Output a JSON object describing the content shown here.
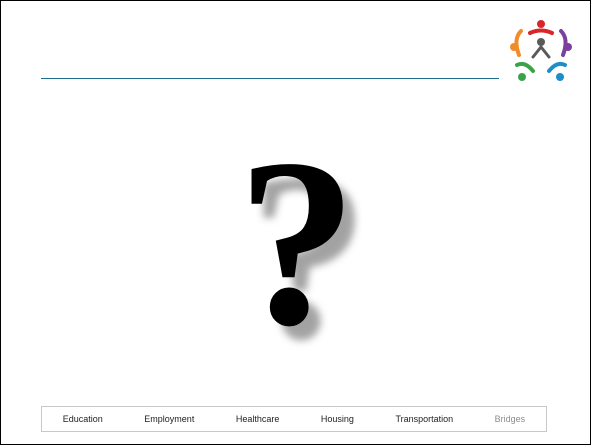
{
  "slide": {
    "logo_icon": "people-circle-logo",
    "graphic_icon": "question-mark-icon",
    "question_glyph": "?",
    "rule_color": "#1f6d8f"
  },
  "nav": {
    "items": [
      {
        "label": "Education"
      },
      {
        "label": "Employment"
      },
      {
        "label": "Healthcare"
      },
      {
        "label": "Housing"
      },
      {
        "label": "Transportation"
      },
      {
        "label": "Bridges",
        "muted": true
      }
    ]
  }
}
